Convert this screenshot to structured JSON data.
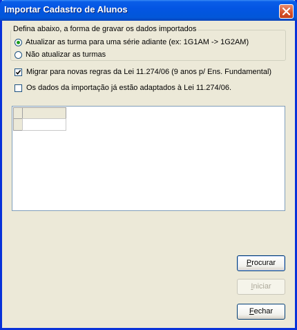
{
  "window": {
    "title": "Importar Cadastro de Alunos"
  },
  "options_group": {
    "legend": "Defina abaixo, a forma de gravar os dados importados",
    "radio_advance_label": "Atualizar as turma para uma série adiante (ex: 1G1AM -> 1G2AM)",
    "radio_no_update_label": "Não atualizar as turmas",
    "selected": "radio_advance"
  },
  "checkbox_migrate": {
    "label": "Migrar para novas regras da  Lei 11.274/06 (9 anos p/ Ens. Fundamental)",
    "checked": true
  },
  "checkbox_adapted": {
    "label": "Os dados da importação já estão adaptados à Lei 11.274/06.",
    "checked": false
  },
  "buttons": {
    "search": {
      "label": "Procurar",
      "accel": "P",
      "rest": "rocurar"
    },
    "start": {
      "label": "Iniciar",
      "accel": "I",
      "rest": "niciar"
    },
    "close": {
      "label": "Fechar",
      "accel": "F",
      "rest": "echar"
    }
  }
}
